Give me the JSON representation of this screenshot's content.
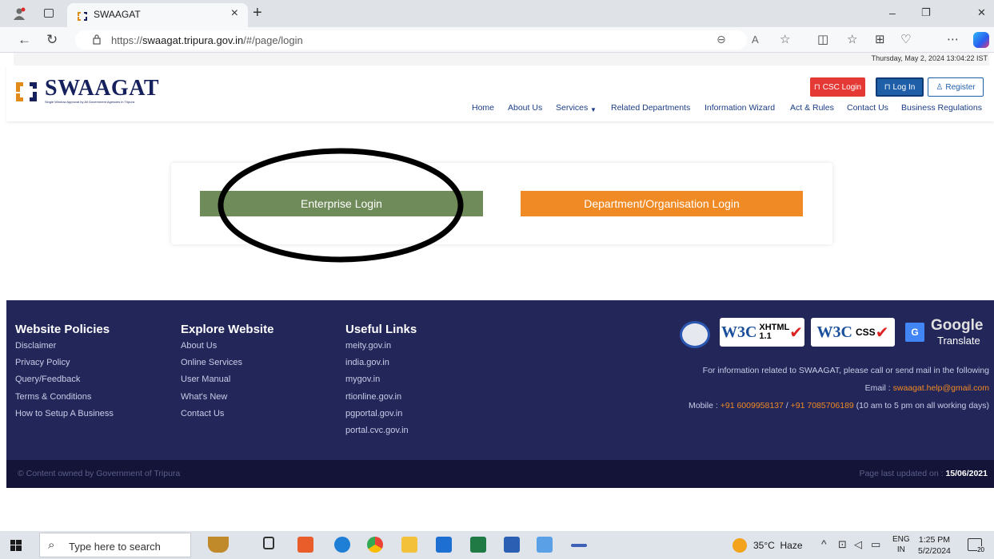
{
  "browser": {
    "tab_title": "SWAAGAT",
    "tab_close": "×",
    "new_tab": "+",
    "url_prefix": "https://",
    "url_domain": "swaagat.tripura.gov.in",
    "url_path": "/#/page/login",
    "window_controls": [
      "–",
      "❐",
      "✕"
    ]
  },
  "site": {
    "datetime": "Thursday, May 2, 2024 13:04:22 IST",
    "logo_text": "SWAAGAT",
    "logo_tagline": "Single Window Approval by All Government Agencies in Tripura",
    "buttons": {
      "csc": "CSC Login",
      "login": "Log In",
      "register": "Register"
    },
    "nav": [
      "Home",
      "About Us",
      "Services",
      "Related Departments",
      "Information Wizard",
      "Act & Rules",
      "Contact Us",
      "Business Regulations"
    ],
    "colors": {
      "brand": "#15205c",
      "nav": "#1b3d86",
      "csc": "#e53935",
      "login": "#1f5fa8"
    }
  },
  "login": {
    "enterprise_label": "Enterprise Login",
    "department_label": "Department/Organisation Login",
    "colors": {
      "enterprise": "#6f8b5a",
      "department": "#f08a24"
    }
  },
  "footer": {
    "policies": {
      "heading": "Website Policies",
      "items": [
        "Disclaimer",
        "Privacy Policy",
        "Query/Feedback",
        "Terms & Conditions",
        "How to Setup A Business"
      ]
    },
    "explore": {
      "heading": "Explore Website",
      "items": [
        "About Us",
        "Online Services",
        "User Manual",
        "What's New",
        "Contact Us"
      ]
    },
    "useful": {
      "heading": "Useful Links",
      "items": [
        "meity.gov.in",
        "india.gov.in",
        "mygov.in",
        "rtionline.gov.in",
        "pgportal.gov.in",
        "portal.cvc.gov.in"
      ]
    },
    "badges": {
      "w3c": "W3C",
      "xhtml": "XHTML",
      "xhtml_ver": "1.1",
      "css": "CSS",
      "google": "Google",
      "translate": "Translate"
    },
    "info_line": "For information related to SWAAGAT, please call or send mail in the following",
    "email_label": "Email : ",
    "email": "swaagat.help@gmail.com",
    "mobile_label": "Mobile : ",
    "mobile1": "+91 6009958137",
    "mobile_sep": " / ",
    "mobile2": "+91 7085706189",
    "hours": " (10 am to 5 pm on all working days)",
    "copyright": "© Content owned by Government of Tripura",
    "updated_label": "Page last updated on : ",
    "updated_date": "15/06/2021"
  },
  "taskbar": {
    "search_placeholder": "Type here to search",
    "weather": "35°C  Haze",
    "lang_top": "ENG",
    "lang_bottom": "IN",
    "time": "1:25 PM",
    "date": "5/2/2024",
    "notifications": "20"
  }
}
